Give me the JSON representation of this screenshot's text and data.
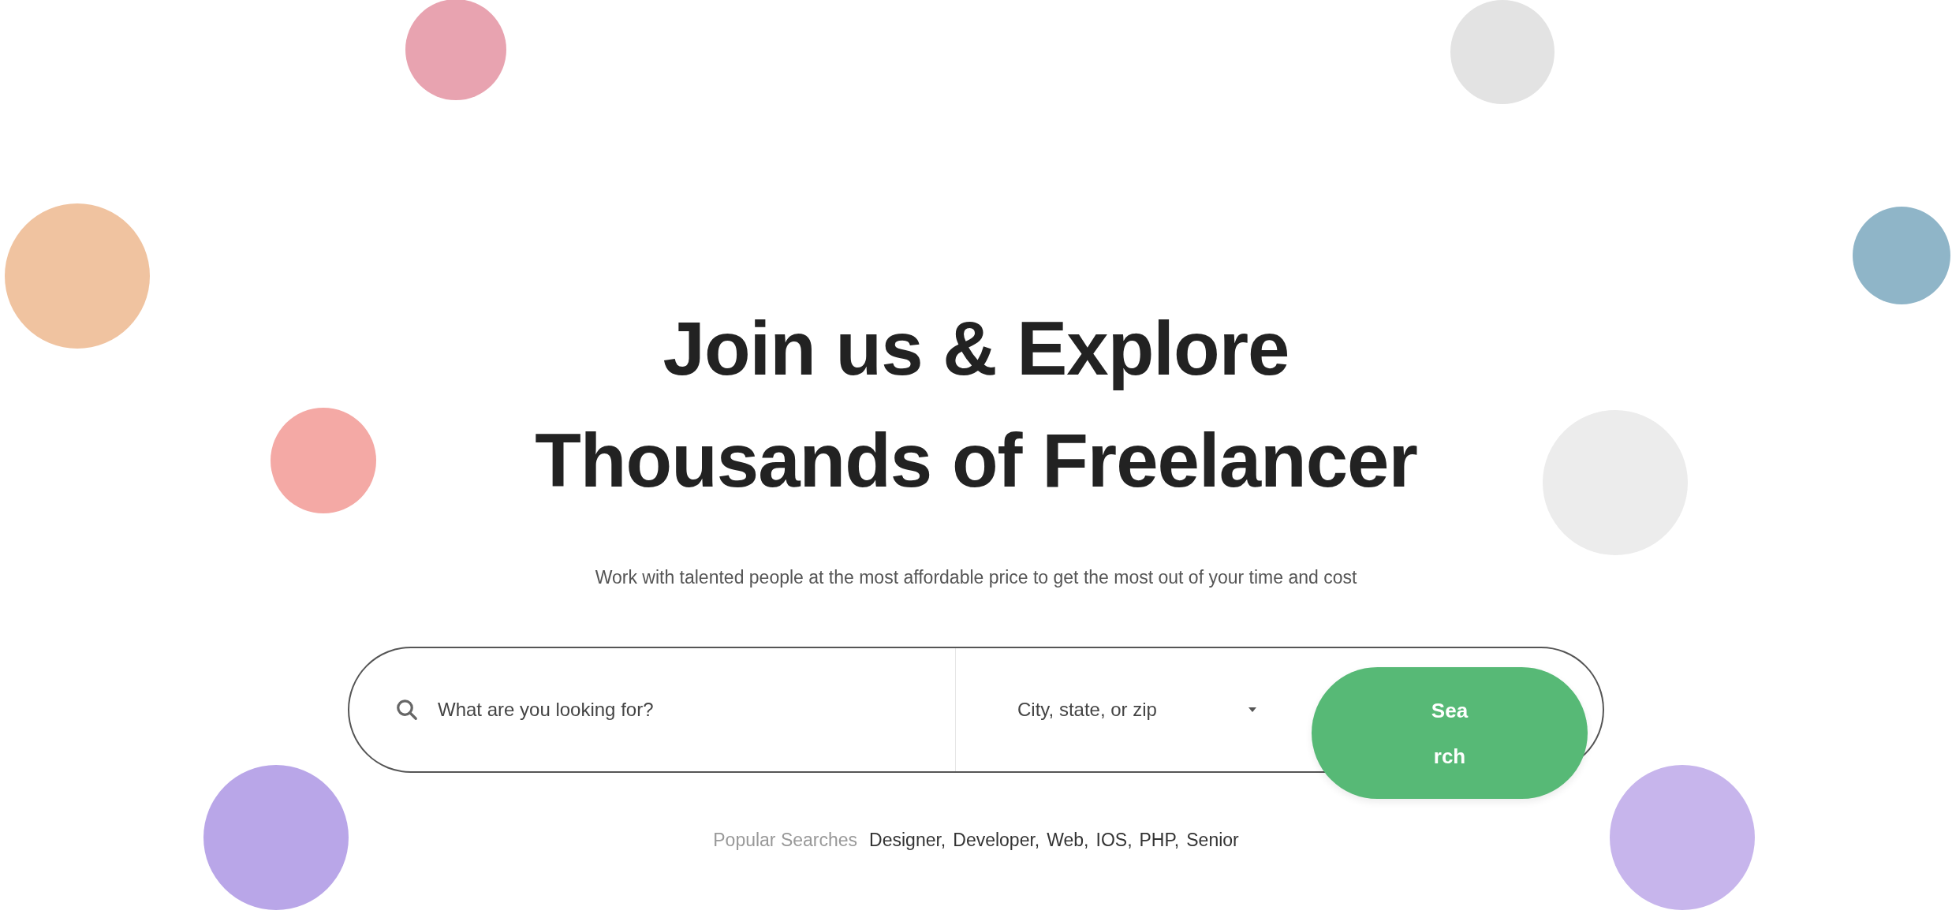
{
  "heading": {
    "lines": [
      "Join us & Explore",
      "Thousands of Freelancer"
    ]
  },
  "subtitle": "Work with talented people at the most affordable price to get the most out of your time and cost",
  "search": {
    "keyword_placeholder": "What are you looking for?",
    "location_placeholder": "City, state, or zip",
    "button": "Search"
  },
  "popular": {
    "label": "Popular Searches",
    "items": [
      "Designer,",
      "Developer,",
      "Web,",
      "IOS,",
      "PHP,",
      "Senior"
    ]
  }
}
